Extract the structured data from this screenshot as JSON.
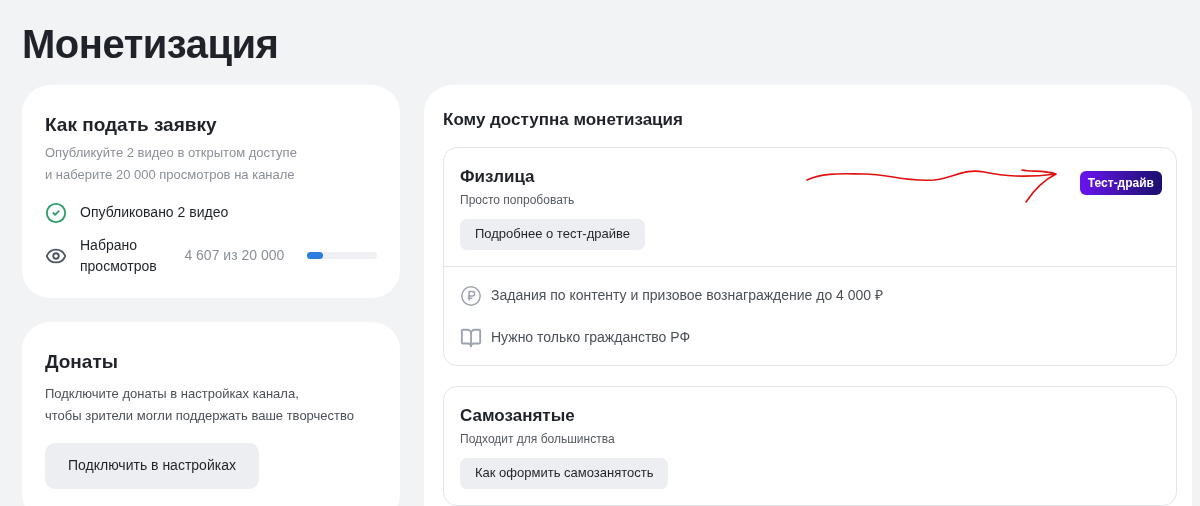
{
  "page_title": "Монетизация",
  "apply_card": {
    "title": "Как подать заявку",
    "description": "Опубликуйте 2 видео в открытом доступе\nи наберите 20 000 просмотров на канале",
    "requirements": [
      {
        "kind": "check",
        "label": "Опубликовано 2 видео"
      },
      {
        "kind": "progress",
        "label": "Набрано\nпросмотров",
        "reading": "4 607 из 20 000",
        "level": 0.23
      }
    ]
  },
  "donations_card": {
    "title": "Донаты",
    "description": "Подключите донаты в настройках канала,\nчтобы зрители могли поддержать ваше творчество",
    "button": "Подключить в настройках"
  },
  "availability": {
    "title": "Кому доступна монетизация",
    "options": [
      {
        "title": "Физлица",
        "subtitle": "Просто попробовать",
        "button": "Подробнее о тест-драйве",
        "badge": "Тест-драйв",
        "annotated": true,
        "features": [
          {
            "kind": "ruble",
            "text": "Задания по контенту и призовое вознаграждение до 4 000 ₽"
          },
          {
            "kind": "book",
            "text": "Нужно только гражданство РФ"
          }
        ]
      },
      {
        "title": "Самозанятые",
        "subtitle": "Подходит для большинства",
        "button": "Как оформить самозанятость",
        "annotated": false
      }
    ]
  }
}
